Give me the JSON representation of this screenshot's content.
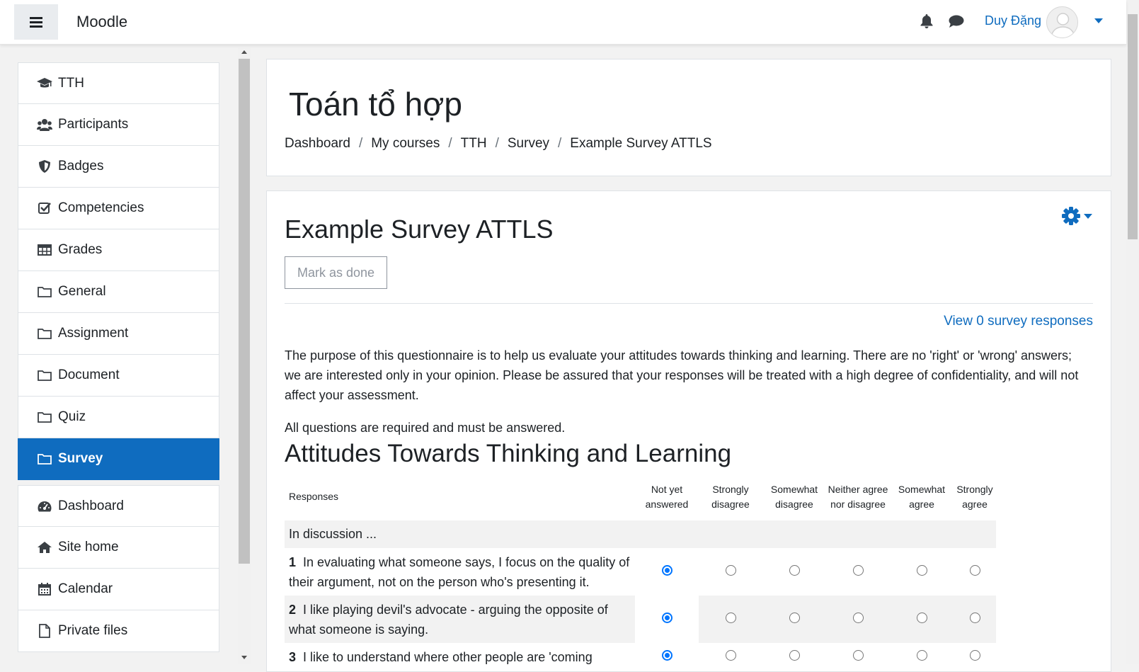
{
  "navbar": {
    "brand": "Moodle",
    "user_name": "Duy Đặng"
  },
  "sidebar": {
    "items": [
      {
        "label": "TTH",
        "icon": "graduation-cap-icon"
      },
      {
        "label": "Participants",
        "icon": "users-icon"
      },
      {
        "label": "Badges",
        "icon": "shield-icon"
      },
      {
        "label": "Competencies",
        "icon": "check-square-icon"
      },
      {
        "label": "Grades",
        "icon": "table-icon"
      },
      {
        "label": "General",
        "icon": "folder-icon"
      },
      {
        "label": "Assignment",
        "icon": "folder-icon"
      },
      {
        "label": "Document",
        "icon": "folder-icon"
      },
      {
        "label": "Quiz",
        "icon": "folder-icon"
      },
      {
        "label": "Survey",
        "icon": "folder-icon",
        "active": true
      }
    ],
    "items2": [
      {
        "label": "Dashboard",
        "icon": "tachometer-icon"
      },
      {
        "label": "Site home",
        "icon": "home-icon"
      },
      {
        "label": "Calendar",
        "icon": "calendar-icon"
      },
      {
        "label": "Private files",
        "icon": "file-icon"
      }
    ]
  },
  "header": {
    "course_title": "Toán tổ hợp",
    "breadcrumb": [
      "Dashboard",
      "My courses",
      "TTH",
      "Survey",
      "Example Survey ATTLS"
    ]
  },
  "main": {
    "activity_title": "Example Survey ATTLS",
    "mark_done": "Mark as done",
    "view_responses": "View 0 survey responses",
    "intro": "The purpose of this questionnaire is to help us evaluate your attitudes towards thinking and learning. There are no 'right' or 'wrong' answers; we are interested only in your opinion. Please be assured that your responses will be treated with a high degree of confidentiality, and will not affect your assessment.",
    "required_note": "All questions are required and must be answered.",
    "section_title": "Attitudes Towards Thinking and Learning",
    "table": {
      "responses_header": "Responses",
      "columns": [
        "Not yet answered",
        "Strongly disagree",
        "Somewhat disagree",
        "Neither agree nor disagree",
        "Somewhat agree",
        "Strongly agree"
      ],
      "group_label": "In discussion ...",
      "questions": [
        {
          "num": "1",
          "text": "In evaluating what someone says, I focus on the quality of their argument, not on the person who's presenting it.",
          "selected": 0
        },
        {
          "num": "2",
          "text": "I like playing devil's advocate - arguing the opposite of what someone is saying.",
          "selected": 0
        },
        {
          "num": "3",
          "text": "I like to understand where other people are 'coming",
          "selected": 0
        }
      ]
    }
  },
  "colors": {
    "accent": "#0f6cbf",
    "active_bg": "#0f6cbf",
    "radio_selected": "#0075ff"
  }
}
